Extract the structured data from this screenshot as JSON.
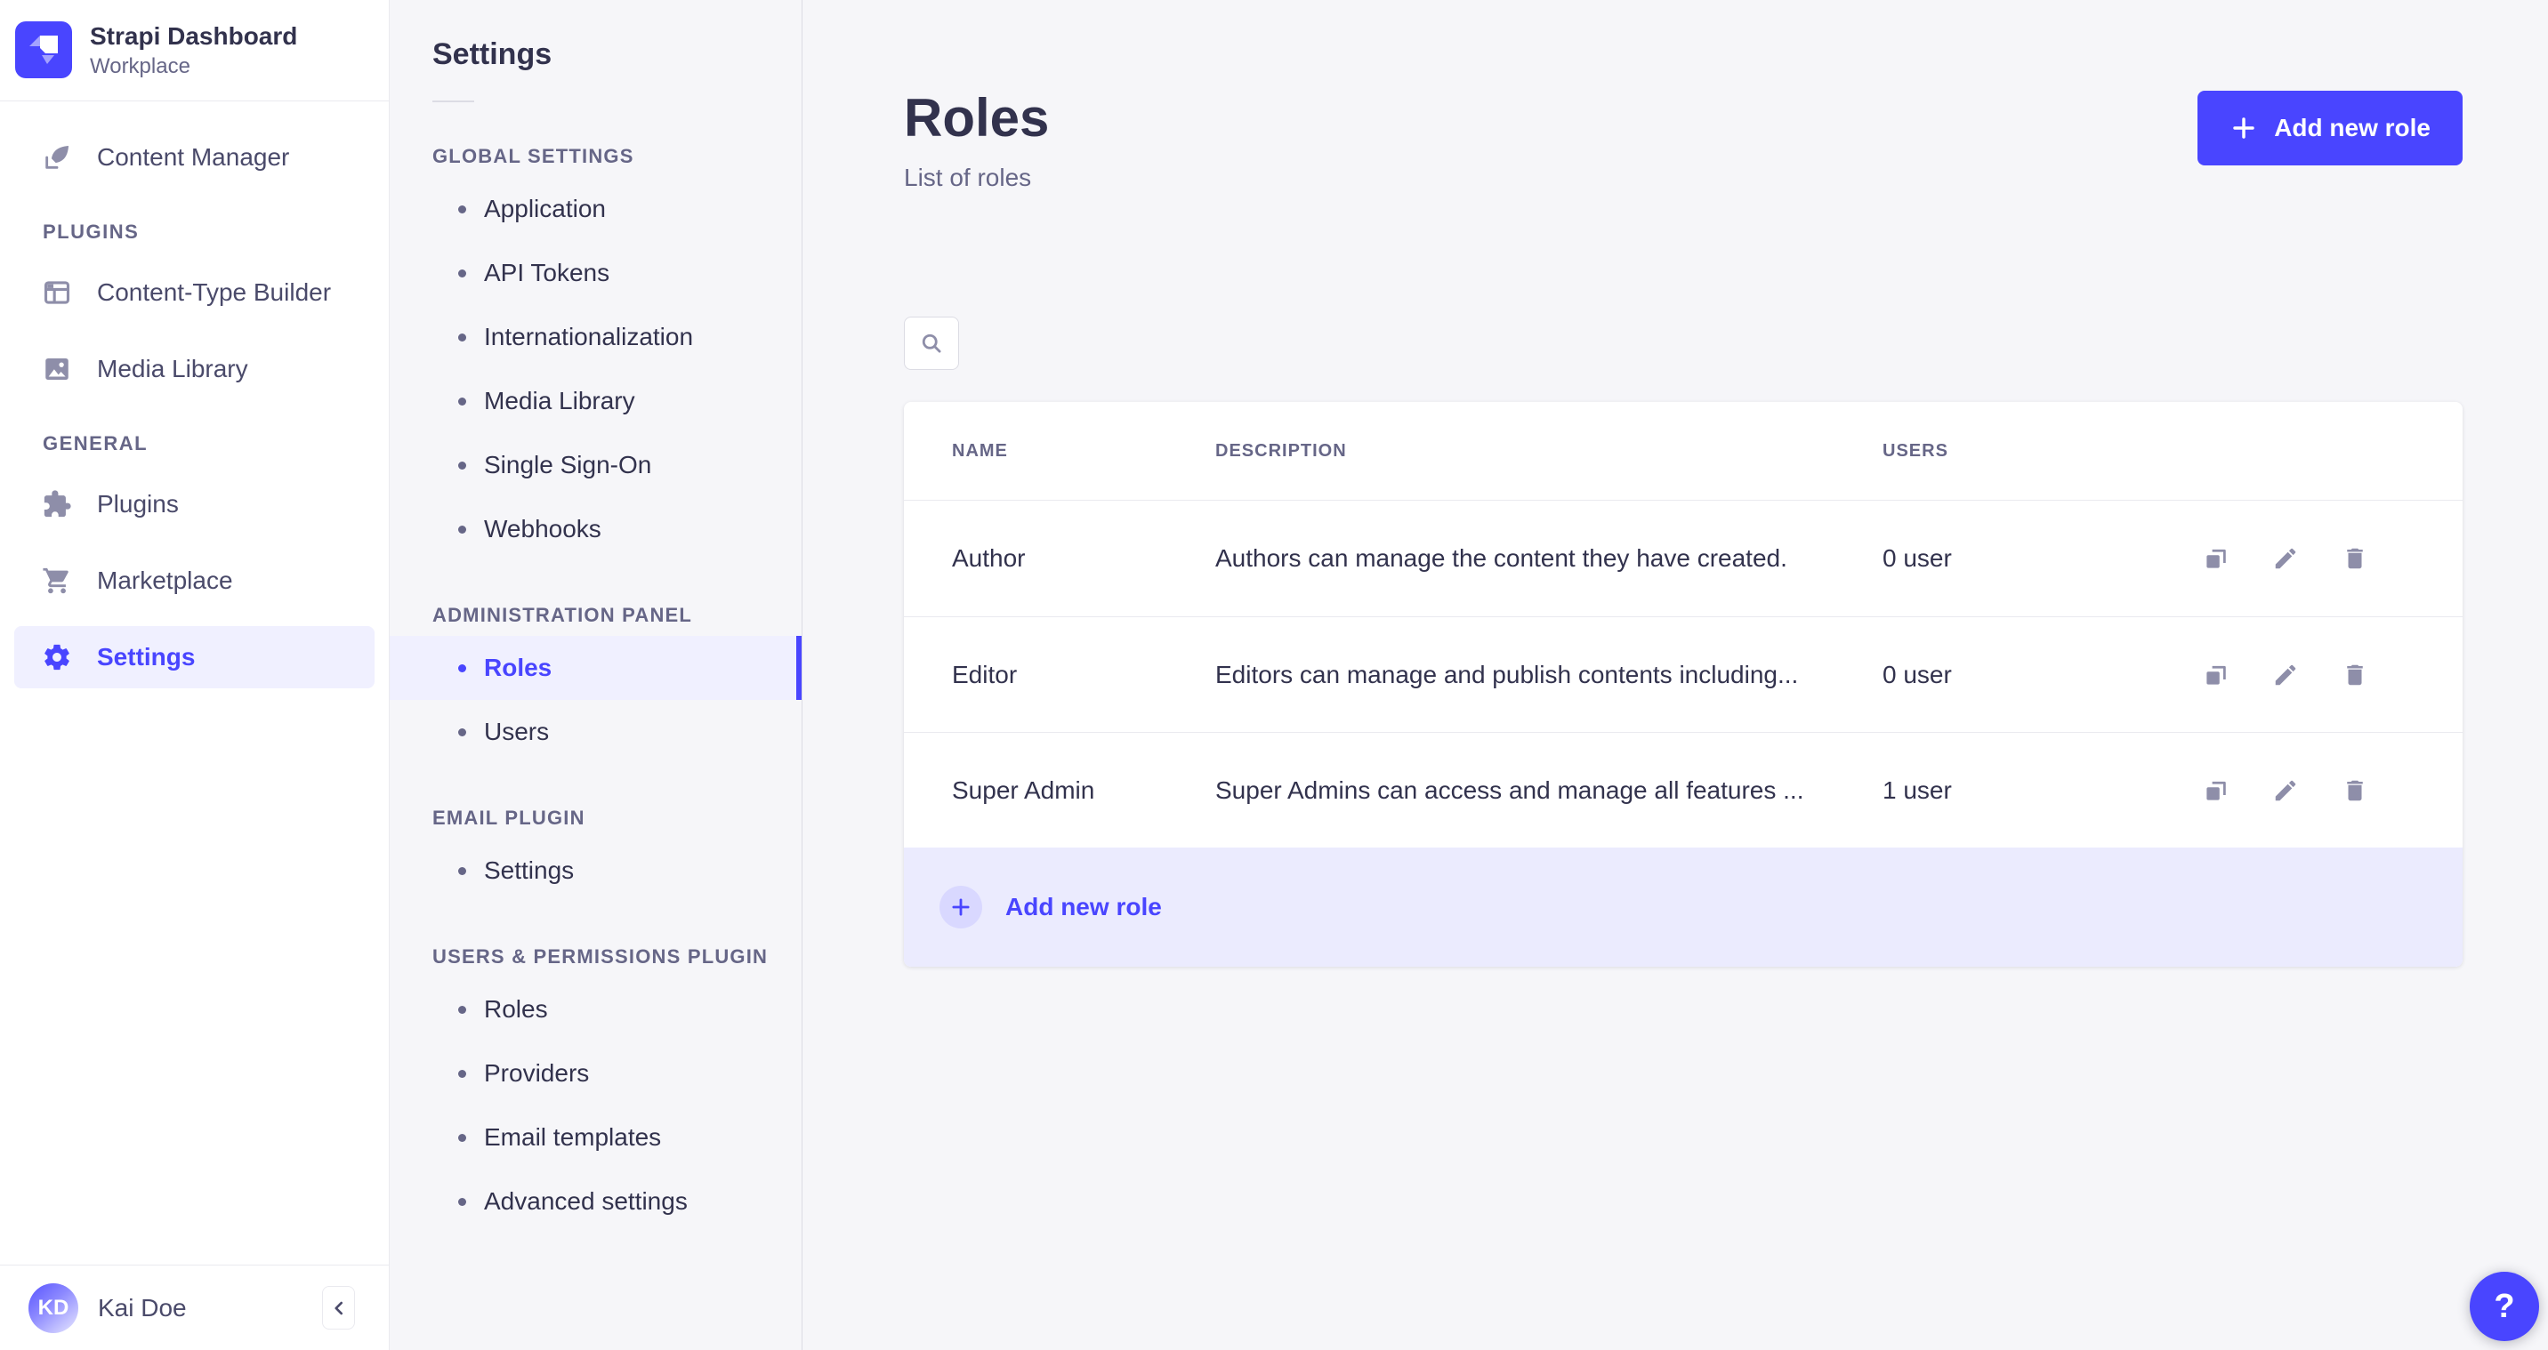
{
  "palette": {
    "primary": "#4945ff",
    "primary_light_bg": "#f0f0ff",
    "footer_row_bg": "#ebebfe",
    "icon_gray": "#8e8ea9",
    "text_dark": "#32324d",
    "text_muted": "#666687"
  },
  "brand": {
    "title": "Strapi Dashboard",
    "subtitle": "Workplace"
  },
  "main_nav": {
    "items_top": [
      {
        "label": "Content Manager",
        "icon": "feather-pen-icon"
      }
    ],
    "sections": [
      {
        "header": "PLUGINS",
        "items": [
          {
            "label": "Content-Type Builder",
            "icon": "layout-grid-icon"
          },
          {
            "label": "Media Library",
            "icon": "image-icon"
          }
        ]
      },
      {
        "header": "GENERAL",
        "items": [
          {
            "label": "Plugins",
            "icon": "puzzle-icon"
          },
          {
            "label": "Marketplace",
            "icon": "cart-icon"
          },
          {
            "label": "Settings",
            "icon": "gear-icon",
            "active": true
          }
        ]
      }
    ],
    "user": {
      "initials": "KD",
      "name": "Kai Doe"
    }
  },
  "subnav": {
    "title": "Settings",
    "sections": [
      {
        "header": "GLOBAL SETTINGS",
        "items": [
          {
            "label": "Application"
          },
          {
            "label": "API Tokens"
          },
          {
            "label": "Internationalization"
          },
          {
            "label": "Media Library"
          },
          {
            "label": "Single Sign-On"
          },
          {
            "label": "Webhooks"
          }
        ]
      },
      {
        "header": "ADMINISTRATION PANEL",
        "items": [
          {
            "label": "Roles",
            "active": true
          },
          {
            "label": "Users"
          }
        ]
      },
      {
        "header": "EMAIL PLUGIN",
        "items": [
          {
            "label": "Settings"
          }
        ]
      },
      {
        "header": "USERS & PERMISSIONS PLUGIN",
        "items": [
          {
            "label": "Roles"
          },
          {
            "label": "Providers"
          },
          {
            "label": "Email templates"
          },
          {
            "label": "Advanced settings"
          }
        ]
      }
    ]
  },
  "page": {
    "title": "Roles",
    "subtitle": "List of roles",
    "add_button": "Add new role",
    "help_label": "?",
    "table": {
      "columns": {
        "name": "NAME",
        "description": "DESCRIPTION",
        "users": "USERS"
      },
      "rows": [
        {
          "name": "Author",
          "description": "Authors can manage the content they have created.",
          "users": "0 user"
        },
        {
          "name": "Editor",
          "description": "Editors can manage and publish contents including...",
          "users": "0 user"
        },
        {
          "name": "Super Admin",
          "description": "Super Admins can access and manage all features ...",
          "users": "1 user"
        }
      ],
      "add_row_label": "Add new role"
    }
  }
}
